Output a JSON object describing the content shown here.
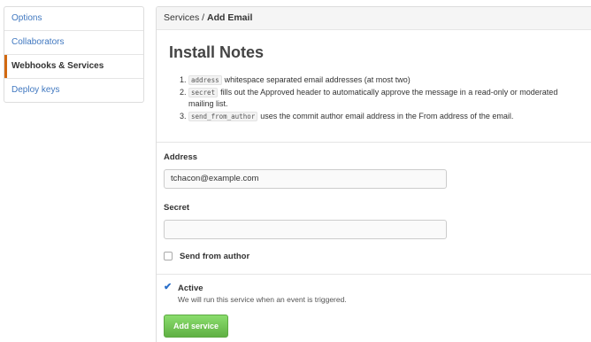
{
  "sidebar": {
    "items": [
      {
        "label": "Options"
      },
      {
        "label": "Collaborators"
      },
      {
        "label": "Webhooks & Services"
      },
      {
        "label": "Deploy keys"
      }
    ]
  },
  "header": {
    "breadcrumb_parent": "Services / ",
    "breadcrumb_current": "Add Email"
  },
  "notes": {
    "title": "Install Notes",
    "items": [
      {
        "code": "address",
        "text": "whitespace separated email addresses (at most two)"
      },
      {
        "code": "secret",
        "text": "fills out the Approved header to automatically approve the message in a read-only or moderated mailing list."
      },
      {
        "code": "send_from_author",
        "text": "uses the commit author email address in the From address of the email."
      }
    ]
  },
  "form": {
    "address_label": "Address",
    "address_value": "tchacon@example.com",
    "secret_label": "Secret",
    "secret_value": "",
    "send_from_author_label": "Send from author",
    "active_label": "Active",
    "active_help": "We will run this service when an event is triggered.",
    "submit_label": "Add service"
  },
  "colors": {
    "accent": "#d26911",
    "link": "#4078c0",
    "button": "#60b044"
  }
}
